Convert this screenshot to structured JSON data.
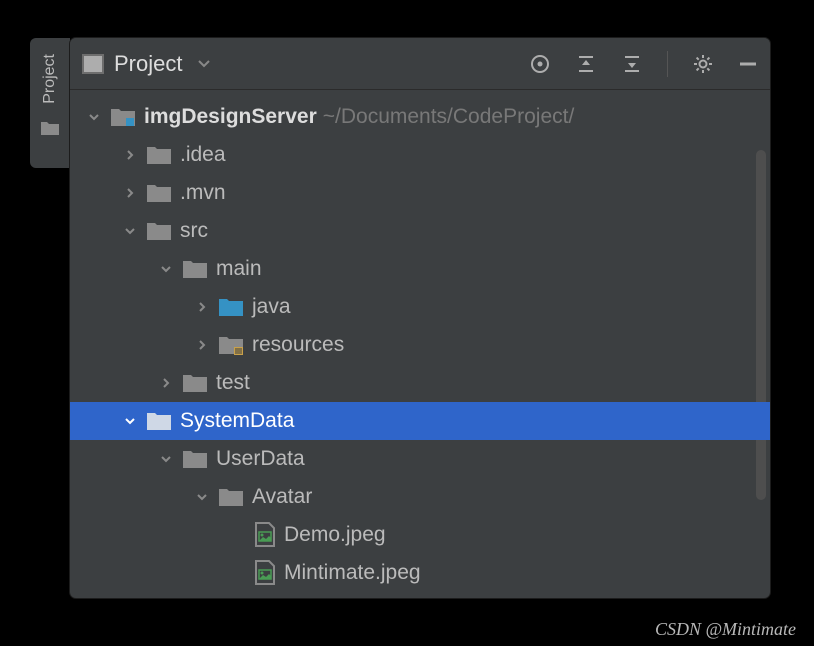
{
  "sidebar": {
    "label": "Project"
  },
  "toolbar": {
    "title": "Project"
  },
  "tree": [
    {
      "depth": 0,
      "chev": "down",
      "icon": "module",
      "label": "imgDesignServer",
      "bold": true,
      "path": "~/Documents/CodeProject/"
    },
    {
      "depth": 1,
      "chev": "right",
      "icon": "folder",
      "label": ".idea"
    },
    {
      "depth": 1,
      "chev": "right",
      "icon": "folder",
      "label": ".mvn"
    },
    {
      "depth": 1,
      "chev": "down",
      "icon": "folder",
      "label": "src"
    },
    {
      "depth": 2,
      "chev": "down",
      "icon": "folder",
      "label": "main"
    },
    {
      "depth": 3,
      "chev": "right",
      "icon": "src-folder",
      "label": "java"
    },
    {
      "depth": 3,
      "chev": "right",
      "icon": "res-folder",
      "label": "resources"
    },
    {
      "depth": 2,
      "chev": "right",
      "icon": "folder",
      "label": "test"
    },
    {
      "depth": 1,
      "chev": "down",
      "icon": "folder",
      "label": "SystemData",
      "selected": true
    },
    {
      "depth": 2,
      "chev": "down",
      "icon": "folder",
      "label": "UserData"
    },
    {
      "depth": 3,
      "chev": "down",
      "icon": "folder",
      "label": "Avatar"
    },
    {
      "depth": 4,
      "chev": "",
      "icon": "image",
      "label": "Demo.jpeg"
    },
    {
      "depth": 4,
      "chev": "",
      "icon": "image",
      "label": "Mintimate.jpeg"
    }
  ],
  "watermark": "CSDN @Mintimate"
}
